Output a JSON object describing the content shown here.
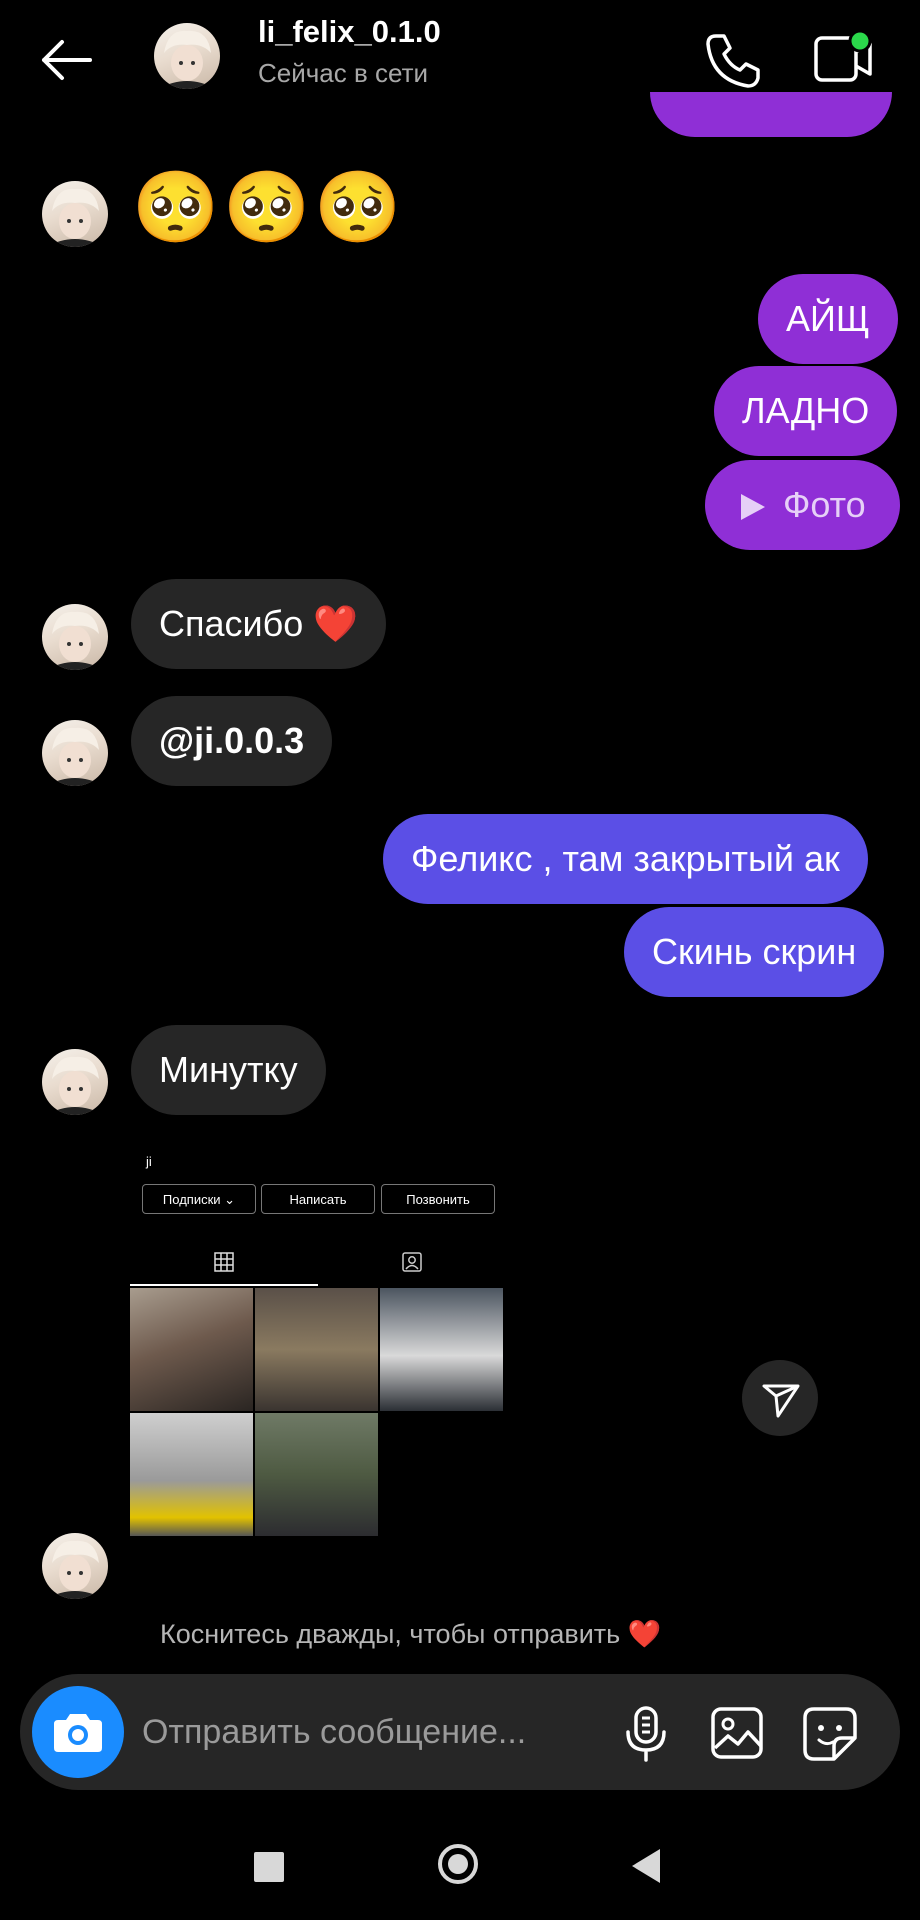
{
  "header": {
    "username": "li_felix_0.1.0",
    "status": "Сейчас в сети",
    "icons": [
      "back-arrow-icon",
      "phone-icon",
      "video-camera-icon"
    ],
    "online_dot_color": "#2bd94b"
  },
  "messages": {
    "emoji": "🥺🥺🥺",
    "sent_1": "АЙЩ",
    "sent_2": "ЛАДНО",
    "sent_3_photo": "Фото",
    "recv_thanks": "Спасибо ❤️",
    "recv_mention": "@ji.0.0.3",
    "sent_4": "Феликс , там закрытый ак",
    "sent_5": "Скинь скрин",
    "recv_minute": "Минутку"
  },
  "screenshot": {
    "profile_name": "ji",
    "buttons": [
      "Подписки ⌄",
      "Написать",
      "Позвонить"
    ],
    "tabs": [
      "grid-icon",
      "tagged-icon"
    ]
  },
  "hint": "Коснитесь дважды, чтобы отправить ❤️",
  "composer": {
    "placeholder": "Отправить сообщение...",
    "icons": [
      "camera-icon",
      "microphone-icon",
      "gallery-icon",
      "sticker-icon"
    ]
  },
  "colors": {
    "sent_purple": "#8f2fd6",
    "sent_violet": "#5b4fe6",
    "received": "#262626",
    "camera_button": "#1a8cff"
  },
  "navbar": {
    "icons": [
      "recents-square-icon",
      "home-circle-icon",
      "back-triangle-icon"
    ]
  }
}
